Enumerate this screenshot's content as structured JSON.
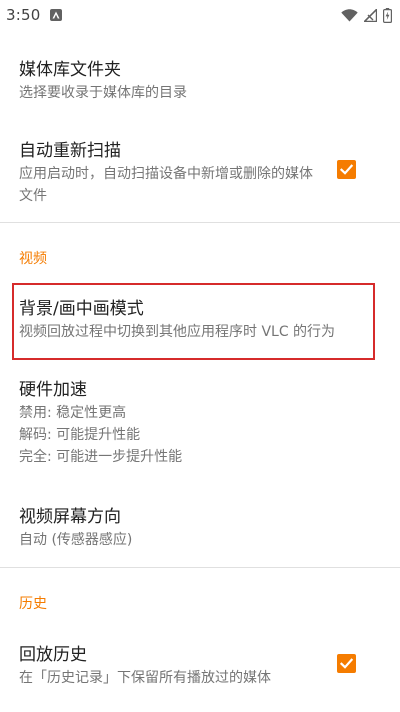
{
  "status_bar": {
    "time": "3:50"
  },
  "media_library": {
    "title": "媒体库文件夹",
    "summary": "选择要收录于媒体库的目录"
  },
  "auto_rescan": {
    "title": "自动重新扫描",
    "summary": "应用启动时，自动扫描设备中新增或删除的媒体文件",
    "checked": true
  },
  "video_category": "视频",
  "background_pip": {
    "title": "背景/画中画模式",
    "summary": "视频回放过程中切换到其他应用程序时 VLC 的行为"
  },
  "hw_accel": {
    "title": "硬件加速",
    "summary_lines": [
      "禁用: 稳定性更高",
      "解码: 可能提升性能",
      "完全: 可能进一步提升性能"
    ]
  },
  "screen_orientation": {
    "title": "视频屏幕方向",
    "summary": "自动 (传感器感应)"
  },
  "history_category": "历史",
  "playback_history": {
    "title": "回放历史",
    "summary": "在「历史记录」下保留所有播放过的媒体",
    "checked": true
  },
  "colors": {
    "accent": "#f57c00",
    "highlight": "#d62b2b"
  }
}
